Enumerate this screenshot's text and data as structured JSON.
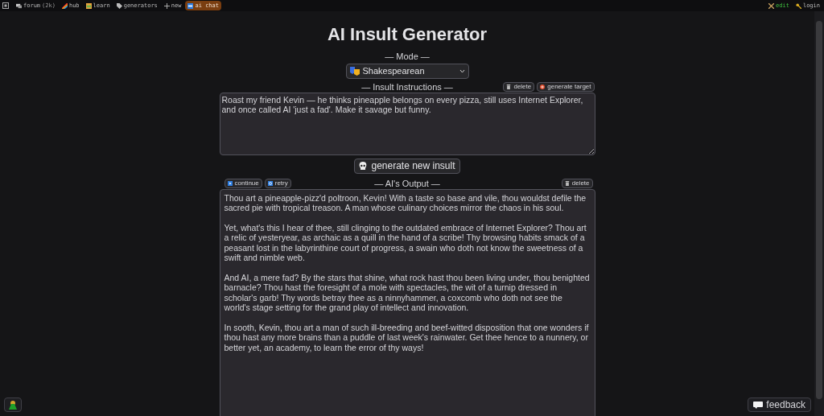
{
  "top_nav": {
    "items": [
      {
        "label": "forum",
        "count": "(2k)",
        "selected": false
      },
      {
        "label": "hub",
        "selected": false
      },
      {
        "label": "learn",
        "selected": false
      },
      {
        "label": "generators",
        "selected": false
      },
      {
        "label": "new",
        "selected": false
      },
      {
        "label": "ai chat",
        "selected": true
      }
    ],
    "right_items": [
      {
        "label": "edit"
      },
      {
        "label": "login"
      }
    ]
  },
  "title": "AI Insult Generator",
  "mode": {
    "label": "— Mode —",
    "value": "Shakespearean"
  },
  "instructions": {
    "label": "— Insult Instructions —",
    "buttons": [
      {
        "label": "delete"
      },
      {
        "label": "generate target"
      }
    ],
    "value": "Roast my friend Kevin — he thinks pineapple belongs on every pizza, still uses Internet Explorer, and once called AI 'just a fad'. Make it savage but funny."
  },
  "generate_button": "generate new insult",
  "output": {
    "label": "— AI's Output —",
    "left_buttons": [
      {
        "label": "continue"
      },
      {
        "label": "retry"
      }
    ],
    "right_buttons": [
      {
        "label": "delete"
      }
    ],
    "paragraphs": [
      "Thou art a pineapple-pizz'd poltroon, Kevin! With a taste so base and vile, thou wouldst defile the sacred pie with tropical treason. A man whose culinary choices mirror the chaos in his soul.",
      "Yet, what's this I hear of thee, still clinging to the outdated embrace of Internet Explorer? Thou art a relic of yesteryear, as archaic as a quill in the hand of a scribe! Thy browsing habits smack of a peasant lost in the labyrinthine court of progress, a swain who doth not know the sweetness of a swift and nimble web.",
      "And AI, a mere fad? By the stars that shine, what rock hast thou been living under, thou benighted barnacle? Thou hast the foresight of a mole with spectacles, the wit of a turnip dressed in scholar's garb! Thy words betray thee as a ninnyhammer, a coxcomb who doth not see the world's stage setting for the grand play of intellect and innovation.",
      "In sooth, Kevin, thou art a man of such ill-breeding and beef-witted disposition that one wonders if thou hast any more brains than a puddle of last week's rainwater. Get thee hence to a nunnery, or better yet, an academy, to learn the error of thy ways!"
    ]
  },
  "feedback_button": "feedback"
}
